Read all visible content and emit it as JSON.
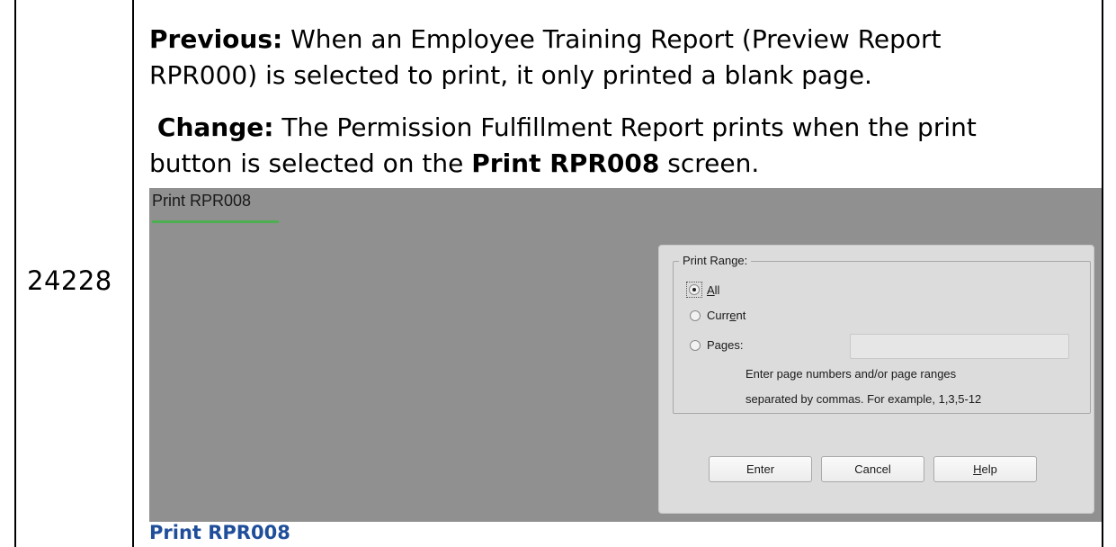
{
  "table": {
    "id_value": "24228"
  },
  "change_note": {
    "previous_label": "Previous:",
    "previous_text": " When an Employee Training Report (Preview Report",
    "previous_text_2": "RPR000) is selected to print, it only printed a blank page.",
    "change_label": "Change:",
    "change_text": " The Permission Fulfillment Report prints when the print",
    "change_text_2_pre": "button is selected on the ",
    "change_text_2_bold": "Print RPR008",
    "change_text_2_post": " screen."
  },
  "screenshot": {
    "page_title": "Print RPR008",
    "dialog": {
      "group_label": "Print Range:",
      "options": [
        {
          "pre": "",
          "u": "A",
          "post": "ll",
          "selected": true
        },
        {
          "pre": "Curr",
          "u": "e",
          "post": "nt",
          "selected": false
        },
        {
          "pre": "Pages:",
          "u": "",
          "post": "",
          "selected": false
        }
      ],
      "pages_value": "",
      "hint_line_1": "Enter page numbers and/or page ranges",
      "hint_line_2": "separated by commas. For example, 1,3,5-12",
      "buttons": {
        "enter": "Enter",
        "cancel": "Cancel",
        "help_u": "H",
        "help_rest": "elp"
      }
    }
  },
  "caption": "Print RPR008"
}
